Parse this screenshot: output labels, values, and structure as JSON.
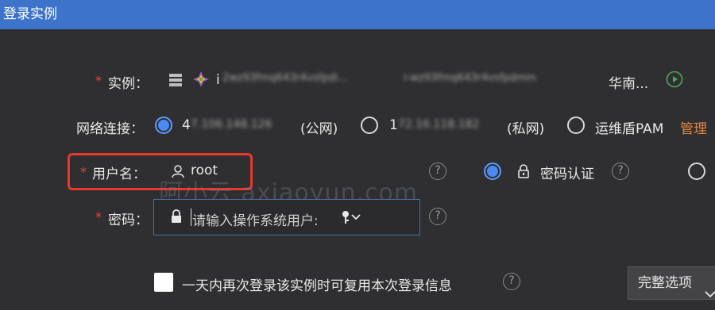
{
  "window": {
    "title": "登录实例"
  },
  "instance": {
    "required_mark": "*",
    "label": "实例：",
    "id_prefix": "i",
    "name_blurred": "2wz93fmq643r4vsfpdi...",
    "id_blurred": "i-wz93fmq643r4vsfpdmm",
    "region": "华南..."
  },
  "network": {
    "label": "网络连接：",
    "options": [
      {
        "prefix": "4",
        "blurred": "7.106.148.126",
        "suffix": "(公网)",
        "checked": true
      },
      {
        "prefix": "1",
        "blurred": "72.16.118.182",
        "suffix": "(私网)",
        "checked": false
      },
      {
        "text": "运维盾PAM",
        "checked": false
      }
    ],
    "manage_link": "管理"
  },
  "username": {
    "required_mark": "*",
    "label": "用户名：",
    "value": "root",
    "help": "?",
    "auth_option": "密码认证",
    "auth_help": "?"
  },
  "password": {
    "required_mark": "*",
    "label": "密码：",
    "placeholder": "请输入操作系统用户:",
    "help": "?"
  },
  "remember": {
    "text": "一天内再次登录该实例时可复用本次登录信息",
    "help": "?"
  },
  "full_options_button": "完整选项",
  "watermark": "阿小云 axiaoyun.com",
  "colors": {
    "titlebar": "#3d73c8",
    "background": "#2f2f31",
    "radio_active": "#4a8af4",
    "required": "#e8453c",
    "link": "#e0863c",
    "highlight": "#e8382c"
  }
}
